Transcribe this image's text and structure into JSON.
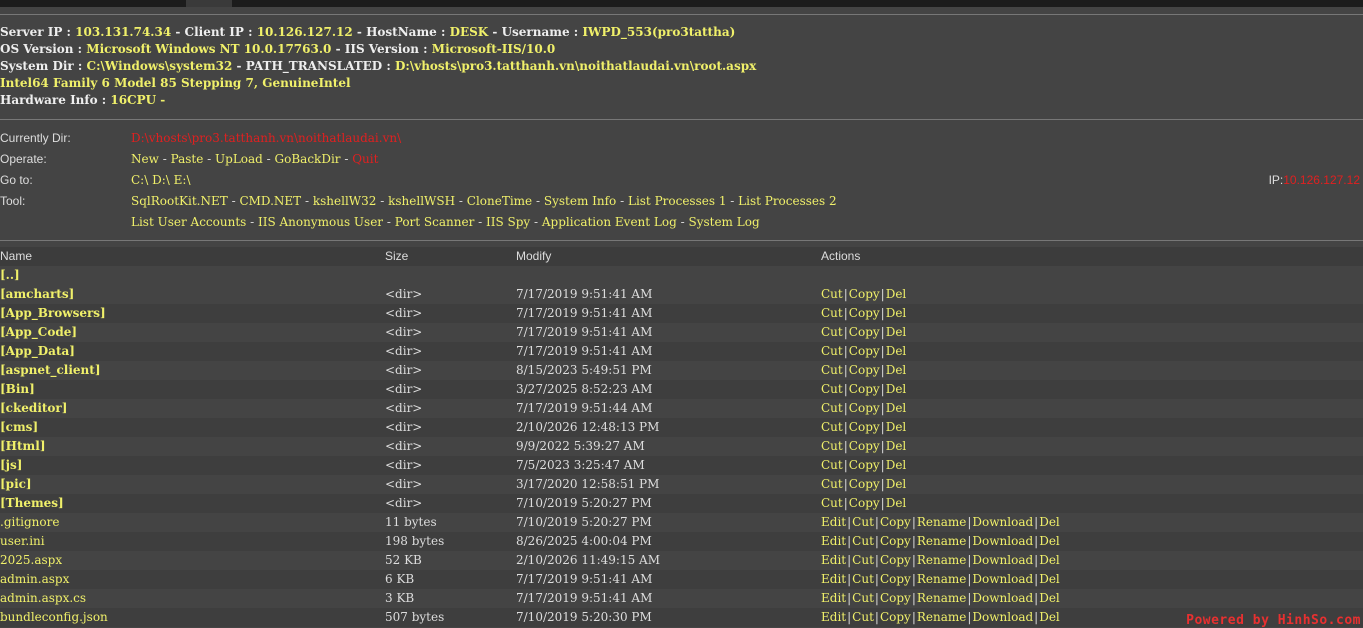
{
  "server_info": {
    "server_ip_label": "Server IP : ",
    "server_ip": "103.131.74.34",
    "client_ip_label": " - Client IP : ",
    "client_ip": "10.126.127.12",
    "hostname_label": " - HostName : ",
    "hostname": "DESK",
    "username_label": " - Username : ",
    "username": "IWPD_553(pro3tattha)",
    "os_label": "OS Version : ",
    "os": "Microsoft Windows NT 10.0.17763.0",
    "iis_label": " - IIS Version : ",
    "iis": "Microsoft-IIS/10.0",
    "sysdir_label": "System Dir : ",
    "sysdir": "C:\\Windows\\system32",
    "path_label": " - PATH_TRANSLATED : ",
    "path": "D:\\vhosts\\pro3.tatthanh.vn\\noithatlaudai.vn\\root.aspx",
    "cpu": "Intel64 Family 6 Model 85 Stepping 7, GenuineIntel",
    "hw_label": "Hardware Info : ",
    "hw": "16CPU -"
  },
  "operations": {
    "currently_dir_label": "Currently Dir:",
    "currently_dir": "D:\\vhosts\\pro3.tatthanh.vn\\noithatlaudai.vn\\",
    "operate_label": "Operate:",
    "operate_links": [
      "New",
      "Paste",
      "UpLoad",
      "GoBackDir"
    ],
    "quit": "Quit",
    "goto_label": "Go to:",
    "drives": [
      "C:\\",
      "D:\\",
      "E:\\"
    ],
    "ip_label": "IP:",
    "ip_value": "10.126.127.12",
    "tool_label": "Tool:",
    "tools_line1": [
      "SqlRootKit.NET",
      "CMD.NET",
      "kshellW32",
      "kshellWSH",
      "CloneTime",
      "System Info",
      "List Processes 1",
      "List Processes 2"
    ],
    "tools_line2": [
      "List User Accounts",
      "IIS Anonymous User",
      "Port Scanner",
      "IIS Spy",
      "Application Event Log",
      "System Log"
    ]
  },
  "table": {
    "headers": [
      "Name",
      "Size",
      "Modify",
      "Actions"
    ],
    "parent": "[..]",
    "dirs": [
      {
        "name": "[amcharts]",
        "size": "<dir>",
        "modify": "7/17/2019 9:51:41 AM"
      },
      {
        "name": "[App_Browsers]",
        "size": "<dir>",
        "modify": "7/17/2019 9:51:41 AM"
      },
      {
        "name": "[App_Code]",
        "size": "<dir>",
        "modify": "7/17/2019 9:51:41 AM"
      },
      {
        "name": "[App_Data]",
        "size": "<dir>",
        "modify": "7/17/2019 9:51:41 AM"
      },
      {
        "name": "[aspnet_client]",
        "size": "<dir>",
        "modify": "8/15/2023 5:49:51 PM"
      },
      {
        "name": "[Bin]",
        "size": "<dir>",
        "modify": "3/27/2025 8:52:23 AM"
      },
      {
        "name": "[ckeditor]",
        "size": "<dir>",
        "modify": "7/17/2019 9:51:44 AM"
      },
      {
        "name": "[cms]",
        "size": "<dir>",
        "modify": "2/10/2026 12:48:13 PM"
      },
      {
        "name": "[Html]",
        "size": "<dir>",
        "modify": "9/9/2022 5:39:27 AM"
      },
      {
        "name": "[js]",
        "size": "<dir>",
        "modify": "7/5/2023 3:25:47 AM"
      },
      {
        "name": "[pic]",
        "size": "<dir>",
        "modify": "3/17/2020 12:58:51 PM"
      },
      {
        "name": "[Themes]",
        "size": "<dir>",
        "modify": "7/10/2019 5:20:27 PM"
      }
    ],
    "dir_actions": [
      "Cut",
      "Copy",
      "Del"
    ],
    "files": [
      {
        "name": ".gitignore",
        "size": "11 bytes",
        "modify": "7/10/2019 5:20:27 PM"
      },
      {
        "name": "user.ini",
        "size": "198 bytes",
        "modify": "8/26/2025 4:00:04 PM"
      },
      {
        "name": "2025.aspx",
        "size": "52 KB",
        "modify": "2/10/2026 11:49:15 AM"
      },
      {
        "name": "admin.aspx",
        "size": "6 KB",
        "modify": "7/17/2019 9:51:41 AM"
      },
      {
        "name": "admin.aspx.cs",
        "size": "3 KB",
        "modify": "7/17/2019 9:51:41 AM"
      },
      {
        "name": "bundleconfig.json",
        "size": "507 bytes",
        "modify": "7/10/2019 5:20:30 PM"
      }
    ],
    "file_actions": [
      "Edit",
      "Cut",
      "Copy",
      "Rename",
      "Download",
      "Del"
    ]
  },
  "watermark": "Powered by HinhSo.com",
  "colors": {
    "background": "#444444",
    "link": "#f0f06a",
    "alert": "#e02020",
    "text": "#dddddd"
  }
}
